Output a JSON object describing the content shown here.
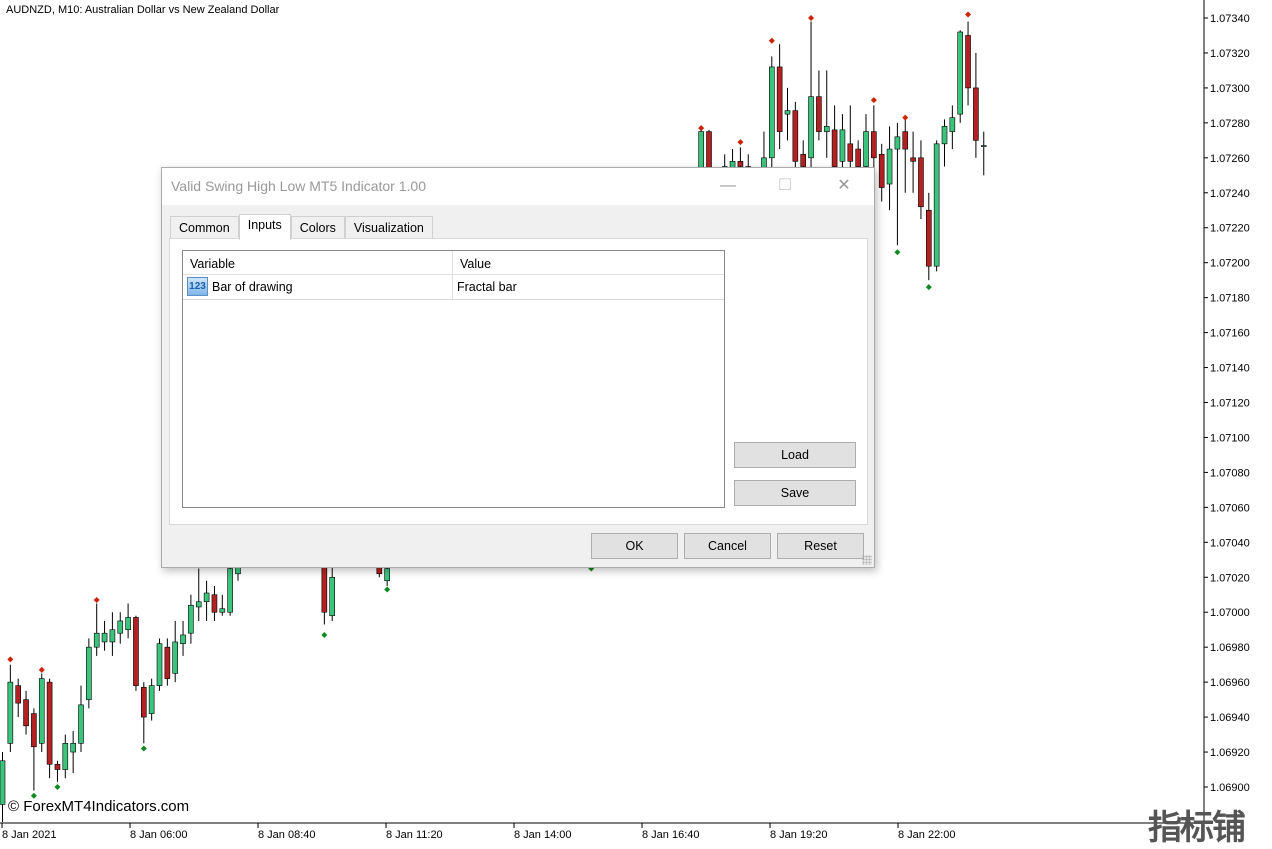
{
  "chart": {
    "title": "AUDNZD, M10:  Australian Dollar vs New Zealand Dollar",
    "copyright": "© ForexMT4Indicators.com",
    "watermark": "指标铺",
    "colors": {
      "bull": "#3cc47c",
      "bear": "#b22222",
      "fractal_high": "#cc2200",
      "fractal_low": "#118822",
      "axis": "#000000"
    },
    "price_labels": [
      "1.07340",
      "1.07320",
      "1.07300",
      "1.07280",
      "1.07260",
      "1.07240",
      "1.07220",
      "1.07200",
      "1.07180",
      "1.07160",
      "1.07140",
      "1.07120",
      "1.07100",
      "1.07080",
      "1.07060",
      "1.07040",
      "1.07020",
      "1.07000",
      "1.06980",
      "1.06960",
      "1.06940",
      "1.06920",
      "1.06900"
    ],
    "time_labels": [
      "8 Jan 2021",
      "8 Jan 06:00",
      "8 Jan 08:40",
      "8 Jan 11:20",
      "8 Jan 14:00",
      "8 Jan 16:40",
      "8 Jan 19:20",
      "8 Jan 22:00"
    ],
    "candles": [
      [
        0,
        1.0689,
        1.0692,
        1.0688,
        1.06915
      ],
      [
        1,
        1.06925,
        1.0697,
        1.0692,
        1.0696
      ],
      [
        2,
        1.06958,
        1.06962,
        1.0694,
        1.06948
      ],
      [
        3,
        1.0695,
        1.06955,
        1.0693,
        1.06935
      ],
      [
        4,
        1.06942,
        1.06945,
        1.06898,
        1.06923
      ],
      [
        5,
        1.06925,
        1.06965,
        1.0692,
        1.06962
      ],
      [
        6,
        1.0696,
        1.06962,
        1.06905,
        1.06913
      ],
      [
        7,
        1.06913,
        1.06915,
        1.06903,
        1.0691
      ],
      [
        8,
        1.0691,
        1.0693,
        1.06905,
        1.06925
      ],
      [
        9,
        1.0692,
        1.06932,
        1.06908,
        1.06925
      ],
      [
        10,
        1.06925,
        1.06958,
        1.0692,
        1.06947
      ],
      [
        11,
        1.0695,
        1.06985,
        1.06945,
        1.0698
      ],
      [
        12,
        1.0698,
        1.07005,
        1.06975,
        1.06988
      ],
      [
        13,
        1.06983,
        1.06995,
        1.06978,
        1.06988
      ],
      [
        14,
        1.06983,
        1.07,
        1.06975,
        1.0699
      ],
      [
        15,
        1.06988,
        1.07,
        1.06982,
        1.06995
      ],
      [
        16,
        1.0699,
        1.07005,
        1.06985,
        1.06997
      ],
      [
        17,
        1.06997,
        1.06998,
        1.06955,
        1.06958
      ],
      [
        18,
        1.06957,
        1.0696,
        1.06925,
        1.0694
      ],
      [
        19,
        1.06942,
        1.06962,
        1.06938,
        1.06958
      ],
      [
        20,
        1.06958,
        1.06985,
        1.06955,
        1.06982
      ],
      [
        21,
        1.0698,
        1.06985,
        1.06958,
        1.06962
      ],
      [
        22,
        1.06965,
        1.06995,
        1.0696,
        1.06983
      ],
      [
        23,
        1.06982,
        1.06995,
        1.06975,
        1.06987
      ],
      [
        24,
        1.06988,
        1.0701,
        1.06982,
        1.07004
      ],
      [
        25,
        1.07003,
        1.07025,
        1.06995,
        1.07006
      ],
      [
        26,
        1.07006,
        1.07018,
        1.06995,
        1.07011
      ],
      [
        27,
        1.0701,
        1.07015,
        1.06995,
        1.07
      ],
      [
        28,
        1.07,
        1.0701,
        1.06998,
        1.07002
      ],
      [
        29,
        1.07,
        1.0703,
        1.06998,
        1.07025
      ],
      [
        30,
        1.07022,
        1.0703,
        1.07018,
        1.07026
      ],
      [
        41,
        1.0703,
        1.07035,
        1.06993,
        1.07
      ],
      [
        42,
        1.06998,
        1.0704,
        1.06995,
        1.0702
      ],
      [
        48,
        1.0703,
        1.07035,
        1.0702,
        1.07022
      ],
      [
        49,
        1.07018,
        1.0703,
        1.07015,
        1.07025
      ],
      [
        89,
        1.0724,
        1.07278,
        1.0723,
        1.07275
      ],
      [
        90,
        1.07275,
        1.07276,
        1.07235,
        1.0724
      ],
      [
        92,
        1.07245,
        1.07262,
        1.0724,
        1.07255
      ],
      [
        93,
        1.0725,
        1.07265,
        1.07245,
        1.07258
      ],
      [
        94,
        1.07258,
        1.07266,
        1.0724,
        1.07255
      ],
      [
        95,
        1.07255,
        1.07262,
        1.0724,
        1.0725
      ],
      [
        97,
        1.0725,
        1.07275,
        1.07245,
        1.0726
      ],
      [
        98,
        1.0726,
        1.07318,
        1.0725,
        1.07312
      ],
      [
        99,
        1.07312,
        1.07325,
        1.07265,
        1.07275
      ],
      [
        100,
        1.07285,
        1.073,
        1.0727,
        1.07287
      ],
      [
        101,
        1.07287,
        1.07292,
        1.0725,
        1.07258
      ],
      [
        102,
        1.07262,
        1.0727,
        1.07245,
        1.07255
      ],
      [
        103,
        1.0726,
        1.07338,
        1.0725,
        1.07295
      ],
      [
        104,
        1.07295,
        1.0731,
        1.0727,
        1.07275
      ],
      [
        105,
        1.07275,
        1.0731,
        1.0726,
        1.07278
      ],
      [
        106,
        1.07276,
        1.0729,
        1.0725,
        1.07255
      ],
      [
        107,
        1.07258,
        1.07285,
        1.07245,
        1.07276
      ],
      [
        108,
        1.07268,
        1.0729,
        1.07245,
        1.07258
      ],
      [
        109,
        1.07265,
        1.0727,
        1.0724,
        1.07255
      ],
      [
        110,
        1.07255,
        1.07285,
        1.0725,
        1.07275
      ],
      [
        111,
        1.07275,
        1.0729,
        1.0724,
        1.0726
      ],
      [
        112,
        1.07262,
        1.07268,
        1.07235,
        1.07243
      ],
      [
        113,
        1.07245,
        1.07278,
        1.0723,
        1.07265
      ],
      [
        114,
        1.07265,
        1.0728,
        1.0721,
        1.07272
      ],
      [
        115,
        1.07275,
        1.07282,
        1.0724,
        1.07265
      ],
      [
        116,
        1.0726,
        1.07275,
        1.0724,
        1.07258
      ],
      [
        117,
        1.0726,
        1.0727,
        1.07225,
        1.07232
      ],
      [
        118,
        1.0723,
        1.0724,
        1.0719,
        1.07198
      ],
      [
        119,
        1.07198,
        1.0727,
        1.07195,
        1.07268
      ],
      [
        120,
        1.07268,
        1.07282,
        1.07255,
        1.07278
      ],
      [
        121,
        1.07275,
        1.0729,
        1.07265,
        1.07283
      ],
      [
        122,
        1.07285,
        1.07333,
        1.0728,
        1.07332
      ],
      [
        123,
        1.0733,
        1.07338,
        1.0729,
        1.073
      ],
      [
        124,
        1.073,
        1.0732,
        1.0726,
        1.0727
      ],
      [
        125,
        1.07267,
        1.07275,
        1.0725,
        1.07267
      ]
    ],
    "fractals": [
      [
        1,
        "high",
        1.06973
      ],
      [
        4,
        "low",
        1.06895
      ],
      [
        5,
        "high",
        1.06967
      ],
      [
        7,
        "low",
        1.069
      ],
      [
        12,
        "high",
        1.07007
      ],
      [
        18,
        "low",
        1.06922
      ],
      [
        41,
        "low",
        1.06987
      ],
      [
        49,
        "low",
        1.07013
      ],
      [
        75,
        "low",
        1.07025
      ],
      [
        89,
        "high",
        1.07277
      ],
      [
        94,
        "high",
        1.07269
      ],
      [
        98,
        "high",
        1.07327
      ],
      [
        103,
        "high",
        1.0734
      ],
      [
        111,
        "high",
        1.07293
      ],
      [
        114,
        "low",
        1.07206
      ],
      [
        115,
        "high",
        1.07283
      ],
      [
        118,
        "low",
        1.07186
      ],
      [
        123,
        "high",
        1.07342
      ]
    ]
  },
  "dialog": {
    "title": "Valid Swing High Low MT5 Indicator 1.00",
    "tabs": [
      {
        "label": "Common"
      },
      {
        "label": "Inputs",
        "active": true
      },
      {
        "label": "Colors"
      },
      {
        "label": "Visualization"
      }
    ],
    "table": {
      "headers": [
        "Variable",
        "Value"
      ],
      "rows": [
        {
          "icon": "number-123-icon",
          "icon_text": "123",
          "variable": "Bar of drawing",
          "value": "Fractal bar"
        }
      ]
    },
    "buttons": {
      "load": "Load",
      "save": "Save",
      "ok": "OK",
      "cancel": "Cancel",
      "reset": "Reset"
    },
    "window": {
      "minimize": "—",
      "maximize": "☐",
      "close": "✕"
    }
  }
}
